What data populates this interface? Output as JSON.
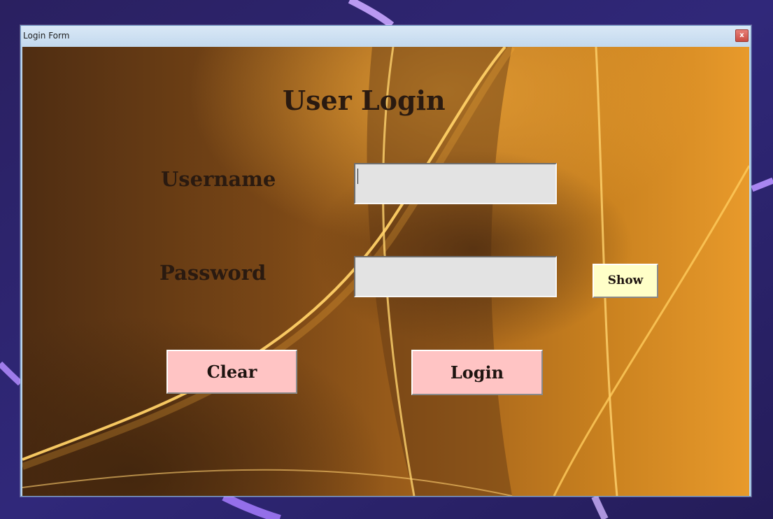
{
  "window": {
    "title": "Login Form",
    "close_glyph": "x"
  },
  "form": {
    "heading": "User Login",
    "username_label": "Username",
    "username_value": "",
    "password_label": "Password",
    "password_value": "",
    "show_label": "Show",
    "clear_label": "Clear",
    "login_label": "Login"
  },
  "colors": {
    "field_bg": "#e3e3e3",
    "action_button_bg": "#ffc4c4",
    "show_button_bg": "#ffffc8",
    "label_text": "#2a1a10",
    "background_gold": "#e8962a",
    "background_brown": "#5a3514",
    "desktop_bg": "#2c2870"
  },
  "icons": {
    "close": "close-icon"
  }
}
